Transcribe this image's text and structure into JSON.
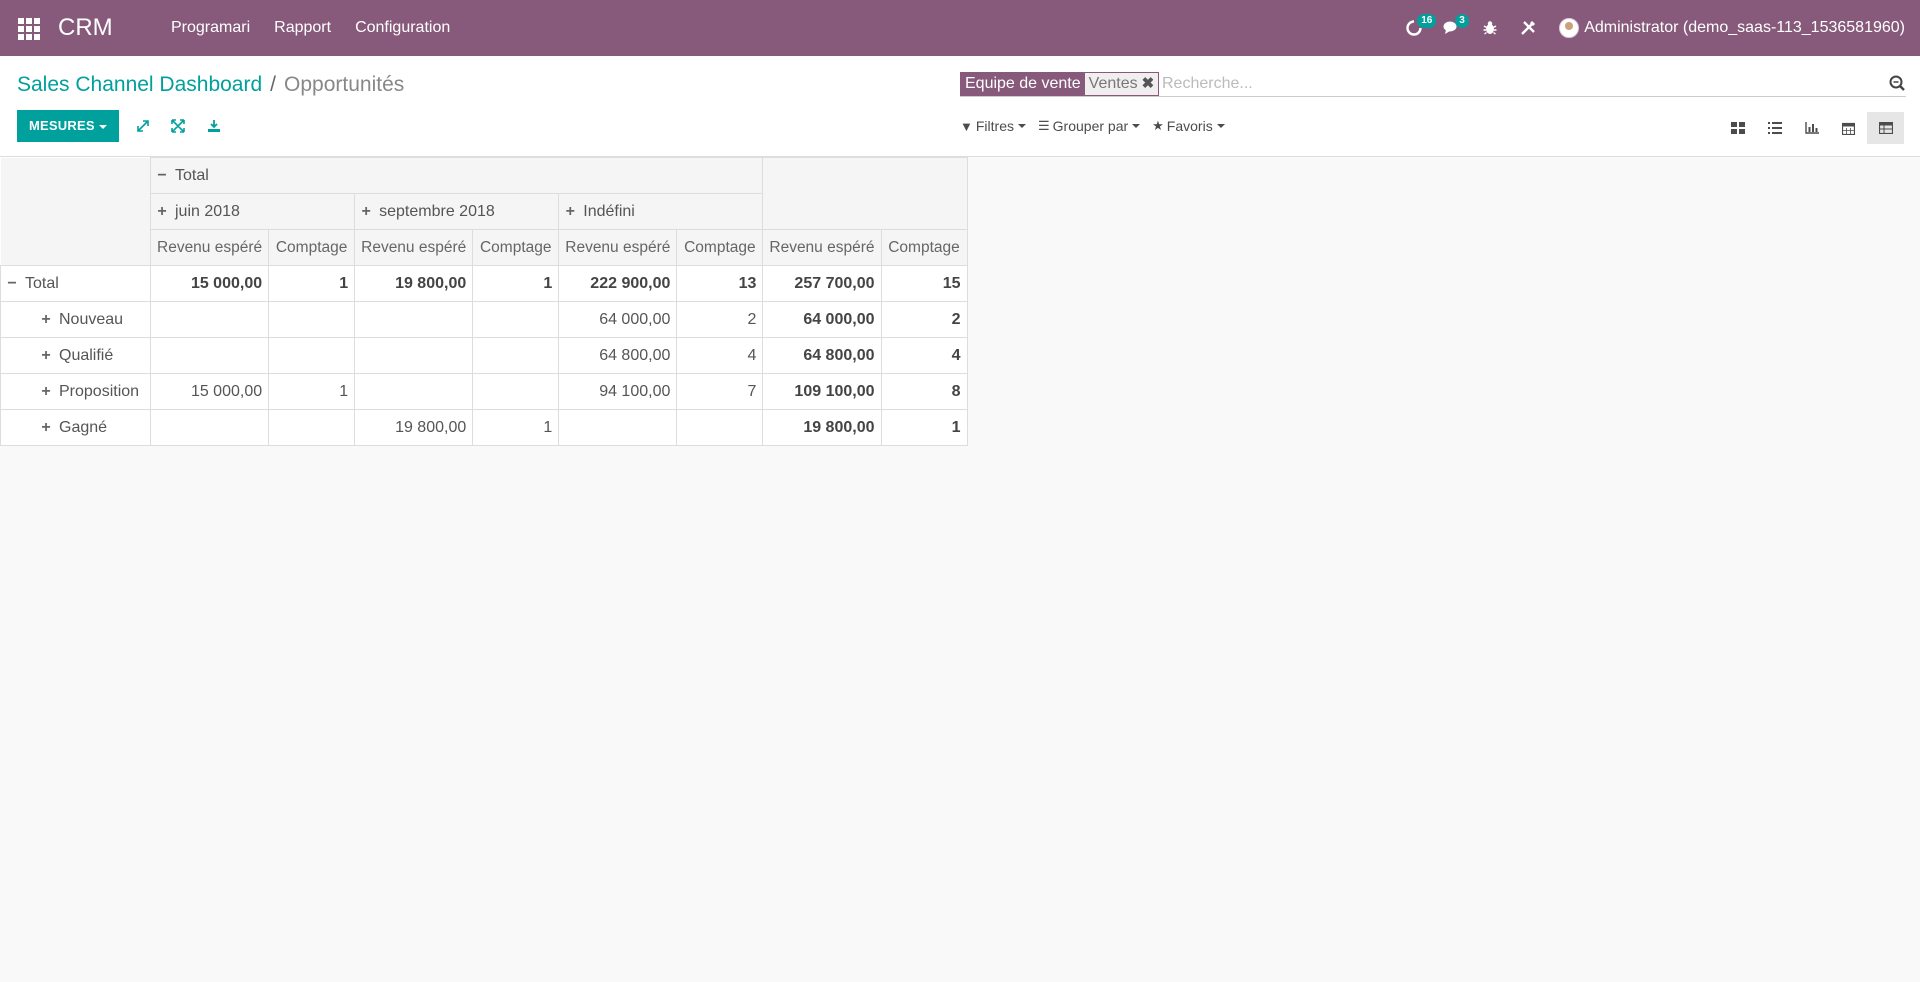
{
  "navbar": {
    "brand": "CRM",
    "menu": [
      "Programari",
      "Rapport",
      "Configuration"
    ],
    "activities_count": "16",
    "messages_count": "3",
    "user": "Administrator (demo_saas-113_1536581960)"
  },
  "breadcrumb": {
    "parent": "Sales Channel Dashboard",
    "separator": "/",
    "current": "Opportunités"
  },
  "toolbar": {
    "measures_label": "MESURES"
  },
  "search": {
    "facet_label": "Equipe de vente",
    "facet_value": "Ventes",
    "placeholder": "Recherche..."
  },
  "filters": {
    "filters_label": "Filtres",
    "groupby_label": "Grouper par",
    "favorites_label": "Favoris"
  },
  "views": [
    "kanban",
    "list",
    "graph",
    "calendar",
    "pivot"
  ],
  "active_view": "pivot",
  "pivot": {
    "col_total": "Total",
    "col_groups": [
      "juin 2018",
      "septembre 2018",
      "Indéfini"
    ],
    "measure_revenue": "Revenu espéré",
    "measure_count": "Comptage",
    "row_total_label": "Total",
    "total_row": [
      "15 000,00",
      "1",
      "19 800,00",
      "1",
      "222 900,00",
      "13",
      "257 700,00",
      "15"
    ],
    "rows": [
      {
        "label": "Nouveau",
        "cells": [
          "",
          "",
          "",
          "",
          "64 000,00",
          "2",
          "64 000,00",
          "2"
        ]
      },
      {
        "label": "Qualifié",
        "cells": [
          "",
          "",
          "",
          "",
          "64 800,00",
          "4",
          "64 800,00",
          "4"
        ]
      },
      {
        "label": "Proposition",
        "cells": [
          "15 000,00",
          "1",
          "",
          "",
          "94 100,00",
          "7",
          "109 100,00",
          "8"
        ]
      },
      {
        "label": "Gagné",
        "cells": [
          "",
          "",
          "19 800,00",
          "1",
          "",
          "",
          "19 800,00",
          "1"
        ]
      }
    ]
  },
  "colors": {
    "navbar": "#875a7b",
    "accent": "#00a09d"
  }
}
